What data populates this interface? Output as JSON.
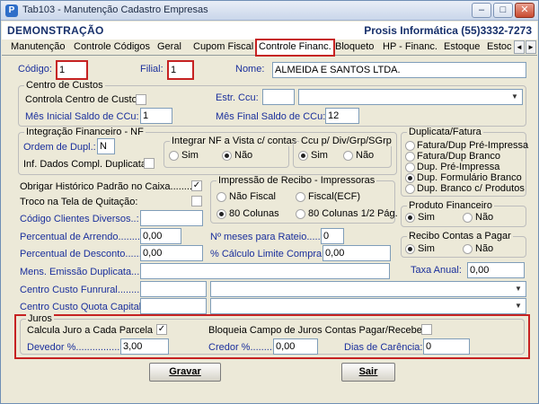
{
  "window": {
    "title": "Tab103 - Manutenção Cadastro Empresas",
    "icon_letter": "P",
    "min_glyph": "–",
    "max_glyph": "□",
    "close_glyph": "✕"
  },
  "header": {
    "left": "DEMONSTRAÇÃO",
    "right": "Prosis Informática (55)3332-7273"
  },
  "tabs": [
    "Manutenção",
    "Controle Códigos",
    "Geral",
    "Cupom Fiscal",
    "Controle Financ.",
    "Bloqueto",
    "HP - Financ.",
    "Estoque",
    "Estoc"
  ],
  "active_tab": "Controle Financ.",
  "tab_scroll": {
    "left": "◄",
    "right": "►"
  },
  "top": {
    "codigo_label": "Código:",
    "codigo_value": "1",
    "filial_label": "Filial:",
    "filial_value": "1",
    "nome_label": "Nome:",
    "nome_value": "ALMEIDA E SANTOS LTDA."
  },
  "centro_custos": {
    "title": "Centro de Custos",
    "controla_label": "Controla Centro de Custos",
    "estr_label": "Estr. Ccu:",
    "estr_value": "",
    "mes_inicial_label": "Mês Inicial Saldo de CCu:",
    "mes_inicial_value": "1",
    "mes_final_label": "Mês Final Saldo de CCu:",
    "mes_final_value": "12"
  },
  "integracao": {
    "title": "Integração Financeiro - NF",
    "ordem_label": "Ordem de Dupl.:",
    "ordem_value": "N",
    "inf_label": "Inf. Dados Compl. Duplicata",
    "nf_vista_title": "Integrar NF a Vista c/ contas",
    "nf_vista_options": [
      "Sim",
      "Não"
    ],
    "nf_vista_selected": "Não",
    "ccu_title": "Ccu p/ Div/Grp/SGrp",
    "ccu_options": [
      "Sim",
      "Não"
    ],
    "ccu_selected": "Sim"
  },
  "duplicata": {
    "title": "Duplicata/Fatura",
    "options": [
      "Fatura/Dup Pré-Impressa",
      "Fatura/Dup Branco",
      "Dup. Pré-Impressa",
      "Dup. Formulário Branco",
      "Dup. Branco c/ Produtos"
    ],
    "selected": "Dup. Formulário Branco"
  },
  "mid": {
    "obrig_label": "Obrigar Histórico Padrão no Caixa..........:",
    "obrig_checked": "✓",
    "troco_label": "Troco na Tela de Quitação:",
    "codigo_clientes_label": "Código Clientes Diversos..:",
    "codigo_clientes_value": ""
  },
  "impressao": {
    "title": "Impressão de Recibo - Impressoras",
    "options": [
      "Não Fiscal",
      "Fiscal(ECF)",
      "80 Colunas",
      "80 Colunas 1/2 Pág."
    ],
    "selected": "80 Colunas"
  },
  "produto_financeiro": {
    "title": "Produto Financeiro",
    "options": [
      "Sim",
      "Não"
    ],
    "selected": "Sim"
  },
  "recibo_contas": {
    "title": "Recibo Contas a Pagar",
    "options": [
      "Sim",
      "Não"
    ],
    "selected": "Sim"
  },
  "percentuais": {
    "arredo_label": "Percentual de Arrendo........:",
    "arredo_value": "0,00",
    "meses_label": "Nº meses para Rateio......:",
    "meses_value": "0",
    "desconto_label": "Percentual de Desconto........:",
    "desconto_value": "0,00",
    "calc_label": "% Cálculo Limite Compra:",
    "calc_value": "0,00",
    "taxa_label": "Taxa Anual:",
    "taxa_value": "0,00"
  },
  "mensagem": {
    "label": "Mens. Emissão Duplicata...:",
    "value": ""
  },
  "centro_custo_funrural": {
    "label": "Centro Custo Funrural.........:",
    "value": ""
  },
  "centro_custo_quota": {
    "label": "Centro Custo Quota Capital:",
    "value": ""
  },
  "juros": {
    "title": "Juros",
    "calcula_label": "Calcula Juro a Cada Parcela",
    "calcula_checked": "✓",
    "bloqueia_label": "Bloqueia Campo de Juros Contas Pagar/Receber",
    "devedor_label": "Devedor %.................:",
    "devedor_value": "3,00",
    "credor_label": "Credor %.........:",
    "credor_value": "0,00",
    "dias_label": "Dias de Carência:",
    "dias_value": "0"
  },
  "buttons": {
    "gravar": "Gravar",
    "sair": "Sair"
  }
}
